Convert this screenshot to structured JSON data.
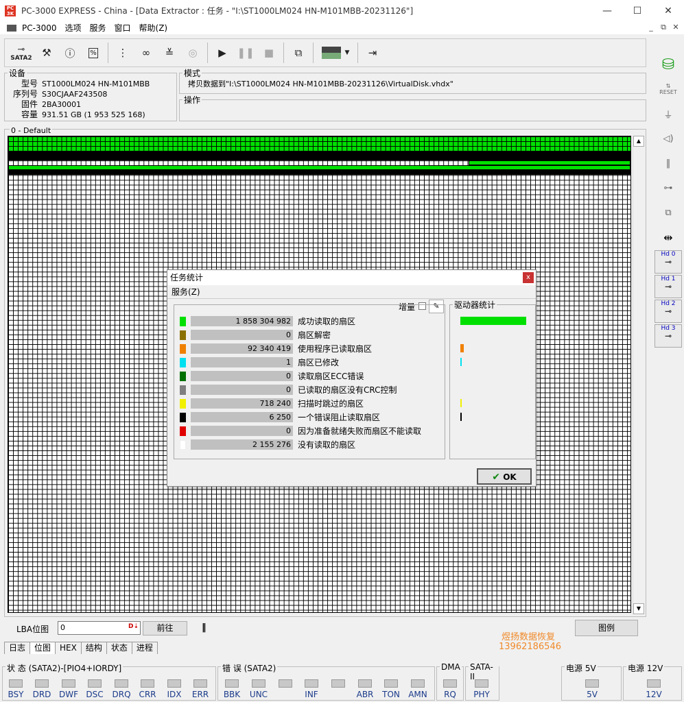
{
  "window": {
    "title": "PC-3000 EXPRESS - China - [Data Extractor : 任务 - \"I:\\ST1000LM024 HN-M101MBB-20231126\"]",
    "minimize": "—",
    "maximize": "☐",
    "close": "✕"
  },
  "menu": {
    "items": [
      "PC-3000",
      "选项",
      "服务",
      "窗口",
      "帮助(Z)"
    ],
    "mdi": [
      "_",
      "⧉",
      "✕"
    ]
  },
  "toolbar": {
    "sata_label": "SATA2"
  },
  "device": {
    "legend": "设备",
    "rows": [
      {
        "label": "型号",
        "value": "ST1000LM024 HN-M101MBB"
      },
      {
        "label": "序列号",
        "value": "S30CJAAF243508"
      },
      {
        "label": "固件",
        "value": "2BA30001"
      },
      {
        "label": "容量",
        "value": "931.51 GB (1 953 525 168)"
      }
    ]
  },
  "mode": {
    "legend": "模式",
    "text": "拷贝数据到\"I:\\ST1000LM024 HN-M101MBB-20231126\\VirtualDisk.vhdx\""
  },
  "operation": {
    "legend": "操作"
  },
  "map": {
    "label": "0 - Default"
  },
  "right_panel": {
    "hd": [
      {
        "label": "Hd 0"
      },
      {
        "label": "Hd 1"
      },
      {
        "label": "Hd 2"
      },
      {
        "label": "Hd 3"
      }
    ],
    "reset": "RESET"
  },
  "lba": {
    "label": "LBA位图",
    "value": "0",
    "go_button": "前往",
    "legend_button": "图例"
  },
  "tabs": [
    "日志",
    "位图",
    "HEX",
    "结构",
    "状态",
    "进程"
  ],
  "watermark": {
    "line1": "煜扬数据恢复",
    "line2": "13962186546"
  },
  "status": {
    "groups": [
      {
        "title": "状 态 (SATA2)-[PIO4+IORDY]",
        "leds": [
          "BSY",
          "DRD",
          "DWF",
          "DSC",
          "DRQ",
          "CRR",
          "IDX",
          "ERR"
        ]
      },
      {
        "title": "错 误 (SATA2)",
        "leds": [
          "BBK",
          "UNC",
          "",
          "INF",
          "",
          "ABR",
          "TON",
          "AMN"
        ]
      },
      {
        "title": "DMA",
        "leds": [
          "RQ"
        ]
      },
      {
        "title": "SATA-II",
        "leds": [
          "PHY"
        ]
      },
      {
        "title": "电源 5V",
        "leds": [
          "5V"
        ]
      },
      {
        "title": "电源 12V",
        "leds": [
          "12V"
        ]
      }
    ]
  },
  "dialog": {
    "title": "任务统计",
    "close": "x",
    "menu": "服务(Z)",
    "increment_label": "增量",
    "drive_stats_label": "驱动器统计",
    "ok": "OK",
    "rows": [
      {
        "value": "1 858 304 982",
        "label": "成功读取的扇区",
        "color": "#00e000",
        "bar": 1.0
      },
      {
        "value": "0",
        "label": "扇区解密",
        "color": "#8a7000",
        "bar": 0
      },
      {
        "value": "92 340 419",
        "label": "使用程序已读取扇区",
        "color": "#f08000",
        "bar": 0.05
      },
      {
        "value": "1",
        "label": "扇区已修改",
        "color": "#00e0f0",
        "bar": 0.02
      },
      {
        "value": "0",
        "label": "读取扇区ECC错误",
        "color": "#007000",
        "bar": 0
      },
      {
        "value": "0",
        "label": "已读取的扇区没有CRC控制",
        "color": "#808080",
        "bar": 0
      },
      {
        "value": "718 240",
        "label": "扫描时跳过的扇区",
        "color": "#f0f000",
        "bar": 0.02
      },
      {
        "value": "6 250",
        "label": "一个错误阻止读取扇区",
        "color": "#000000",
        "bar": 0.02
      },
      {
        "value": "0",
        "label": "因为准备就绪失败而扇区不能读取",
        "color": "#e00000",
        "bar": 0
      },
      {
        "value": "2 155 276",
        "label": "没有读取的扇区",
        "color": "#ffffff",
        "bar": 0
      }
    ]
  }
}
